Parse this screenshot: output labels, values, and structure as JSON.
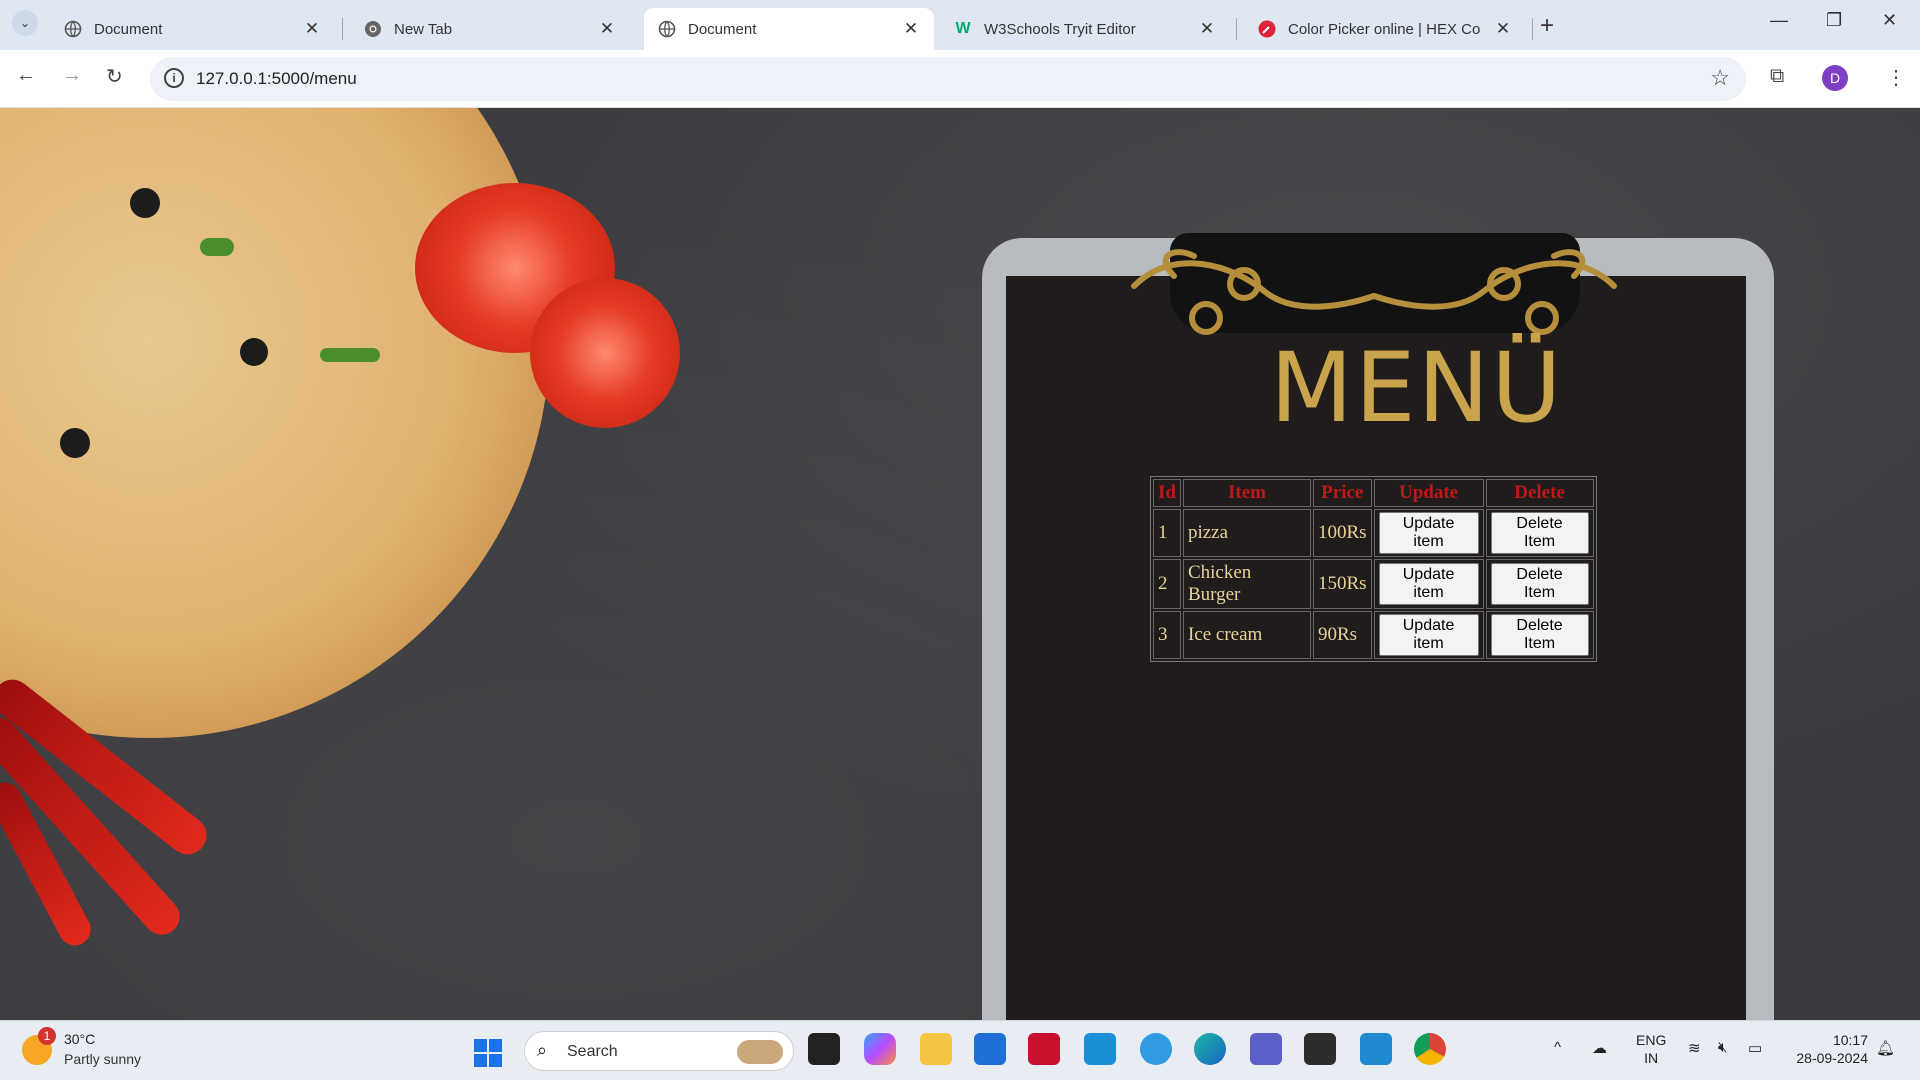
{
  "browser": {
    "tabs": [
      {
        "title": "Document",
        "active": false
      },
      {
        "title": "New Tab",
        "active": false
      },
      {
        "title": "Document",
        "active": true
      },
      {
        "title": "W3Schools Tryit Editor",
        "active": false
      },
      {
        "title": "Color Picker online | HEX Co",
        "active": false
      }
    ],
    "url": "127.0.0.1:5000/menu",
    "profile_initial": "D"
  },
  "page": {
    "menu_heading": "MENÜ",
    "table": {
      "headers": [
        "Id",
        "Item",
        "Price",
        "Update",
        "Delete"
      ],
      "rows": [
        {
          "id": "1",
          "item": "pizza",
          "price": "100Rs",
          "update": "Update item",
          "delete": "Delete Item"
        },
        {
          "id": "2",
          "item": "Chicken Burger",
          "price": "150Rs",
          "update": "Update item",
          "delete": "Delete Item"
        },
        {
          "id": "3",
          "item": "Ice cream",
          "price": "90Rs",
          "update": "Update item",
          "delete": "Delete Item"
        }
      ]
    },
    "colors": {
      "header_text": "#c01818",
      "cell_text": "#e8d39a",
      "menu_gold": "#c9a44c"
    }
  },
  "taskbar": {
    "weather_badge": "1",
    "weather_temp": "30°C",
    "weather_desc": "Partly sunny",
    "search_label": "Search",
    "lang_top": "ENG",
    "lang_bottom": "IN",
    "time": "10:17",
    "date": "28-09-2024"
  }
}
